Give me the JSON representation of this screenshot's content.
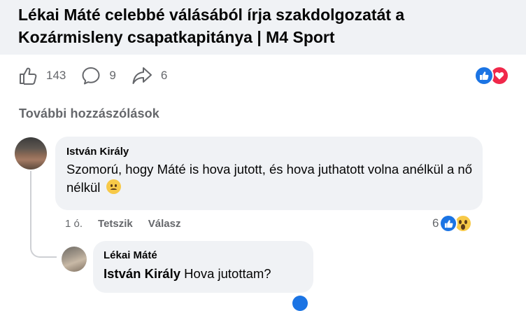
{
  "post": {
    "title_line1": "Lékai Máté celebbé válásából írja szakdolgozatát a",
    "title_line2": "Kozármisleny csapatkapitánya | M4 Sport"
  },
  "actions": {
    "likes": "143",
    "comments": "9",
    "shares": "6",
    "like_icon": "thumbs-up-icon",
    "comment_icon": "comment-bubble-icon",
    "share_icon": "share-arrow-icon",
    "reactions": [
      "like-reaction-icon",
      "love-reaction-icon"
    ]
  },
  "more_comments_label": "További hozzászólások",
  "comments": [
    {
      "author": "István Király",
      "text": "Szomorú, hogy Máté is hova jutott, és hova juthatott volna anélkül a nő nélkül",
      "emoji": "sad-face-emoji",
      "time": "1 ó.",
      "like_label": "Tetszik",
      "reply_label": "Válasz",
      "reaction_count": "6",
      "reactions": [
        "like-reaction-icon",
        "wow-reaction-icon"
      ]
    },
    {
      "author": "Lékai Máté",
      "mention": "István Király",
      "text": "Hova jutottam?"
    }
  ],
  "colors": {
    "accent": "#1b74e4",
    "love": "#f0284a",
    "muted": "#65676b",
    "bubble": "#f0f2f5"
  }
}
